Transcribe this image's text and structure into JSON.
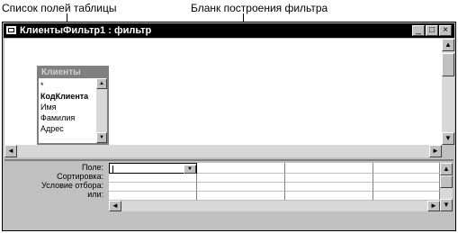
{
  "callouts": {
    "field_list": "Список полей таблицы",
    "filter_grid": "Бланк построения фильтра"
  },
  "window": {
    "title": "КлиентыФильтр1 : фильтр",
    "minimize_glyph": "_",
    "maximize_glyph": "□",
    "close_glyph": "×"
  },
  "field_list": {
    "title": "Клиенты",
    "items": [
      "*",
      "КодКлиента",
      "Имя",
      "Фамилия",
      "Адрес"
    ]
  },
  "grid": {
    "row_labels": [
      "Поле:",
      "Сортировка:",
      "Условие отбора:",
      "или:"
    ]
  },
  "icons": {
    "scroll_up": "▲",
    "scroll_down": "▼",
    "scroll_left": "◄",
    "scroll_right": "►",
    "dropdown": "▼"
  }
}
